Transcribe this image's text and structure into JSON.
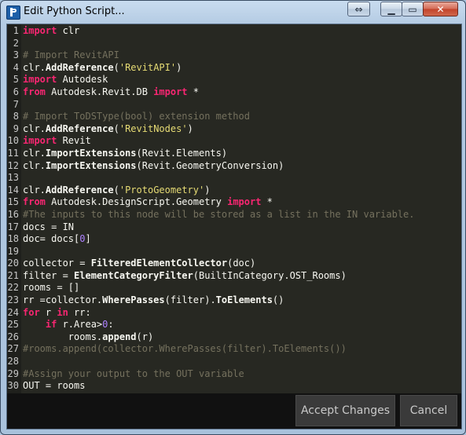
{
  "window": {
    "title": "Edit Python Script...",
    "controls": {
      "restore_icon": "⇔",
      "minimize_icon": "▁",
      "maximize_icon": "▭",
      "close_icon": "✕"
    }
  },
  "editor": {
    "lines": [
      [
        {
          "t": "import",
          "c": "kw"
        },
        {
          "t": " clr",
          "c": ""
        }
      ],
      [],
      [
        {
          "t": "# Import RevitAPI",
          "c": "cm"
        }
      ],
      [
        {
          "t": "clr.",
          "c": ""
        },
        {
          "t": "AddReference",
          "c": "fn"
        },
        {
          "t": "(",
          "c": ""
        },
        {
          "t": "'RevitAPI'",
          "c": "str"
        },
        {
          "t": ")",
          "c": ""
        }
      ],
      [
        {
          "t": "import",
          "c": "kw"
        },
        {
          "t": " Autodesk",
          "c": ""
        }
      ],
      [
        {
          "t": "from",
          "c": "kw"
        },
        {
          "t": " Autodesk.Revit.DB ",
          "c": ""
        },
        {
          "t": "import",
          "c": "kw"
        },
        {
          "t": " *",
          "c": ""
        }
      ],
      [],
      [
        {
          "t": "# Import ToDSType(bool) extension method",
          "c": "cm"
        }
      ],
      [
        {
          "t": "clr.",
          "c": ""
        },
        {
          "t": "AddReference",
          "c": "fn"
        },
        {
          "t": "(",
          "c": ""
        },
        {
          "t": "'RevitNodes'",
          "c": "str"
        },
        {
          "t": ")",
          "c": ""
        }
      ],
      [
        {
          "t": "import",
          "c": "kw"
        },
        {
          "t": " Revit",
          "c": ""
        }
      ],
      [
        {
          "t": "clr.",
          "c": ""
        },
        {
          "t": "ImportExtensions",
          "c": "fn"
        },
        {
          "t": "(Revit.Elements)",
          "c": ""
        }
      ],
      [
        {
          "t": "clr.",
          "c": ""
        },
        {
          "t": "ImportExtensions",
          "c": "fn"
        },
        {
          "t": "(Revit.GeometryConversion)",
          "c": ""
        }
      ],
      [],
      [
        {
          "t": "clr.",
          "c": ""
        },
        {
          "t": "AddReference",
          "c": "fn"
        },
        {
          "t": "(",
          "c": ""
        },
        {
          "t": "'ProtoGeometry'",
          "c": "str"
        },
        {
          "t": ")",
          "c": ""
        }
      ],
      [
        {
          "t": "from",
          "c": "kw"
        },
        {
          "t": " Autodesk.DesignScript.Geometry ",
          "c": ""
        },
        {
          "t": "import",
          "c": "kw"
        },
        {
          "t": " *",
          "c": ""
        }
      ],
      [
        {
          "t": "#The inputs to this node will be stored as a list in the IN variable.",
          "c": "cm"
        }
      ],
      [
        {
          "t": "docs = IN",
          "c": ""
        }
      ],
      [
        {
          "t": "doc= docs[",
          "c": ""
        },
        {
          "t": "0",
          "c": "num"
        },
        {
          "t": "]",
          "c": ""
        }
      ],
      [],
      [
        {
          "t": "collector = ",
          "c": ""
        },
        {
          "t": "FilteredElementCollector",
          "c": "fn"
        },
        {
          "t": "(doc)",
          "c": ""
        }
      ],
      [
        {
          "t": "filter = ",
          "c": ""
        },
        {
          "t": "ElementCategoryFilter",
          "c": "fn"
        },
        {
          "t": "(BuiltInCategory.OST_Rooms)",
          "c": ""
        }
      ],
      [
        {
          "t": "rooms = []",
          "c": ""
        }
      ],
      [
        {
          "t": "rr =collector.",
          "c": ""
        },
        {
          "t": "WherePasses",
          "c": "fn"
        },
        {
          "t": "(filter).",
          "c": ""
        },
        {
          "t": "ToElements",
          "c": "fn"
        },
        {
          "t": "()",
          "c": ""
        }
      ],
      [
        {
          "t": "for",
          "c": "kw"
        },
        {
          "t": " r ",
          "c": ""
        },
        {
          "t": "in",
          "c": "kw"
        },
        {
          "t": " rr:",
          "c": ""
        }
      ],
      [
        {
          "t": "    ",
          "c": ""
        },
        {
          "t": "if",
          "c": "kw"
        },
        {
          "t": " r.Area>",
          "c": ""
        },
        {
          "t": "0",
          "c": "num"
        },
        {
          "t": ":",
          "c": ""
        }
      ],
      [
        {
          "t": "        rooms.",
          "c": ""
        },
        {
          "t": "append",
          "c": "fn"
        },
        {
          "t": "(r)",
          "c": ""
        }
      ],
      [
        {
          "t": "#rooms.append(collector.WherePasses(filter).ToElements())",
          "c": "cm"
        }
      ],
      [],
      [
        {
          "t": "#Assign your output to the OUT variable",
          "c": "cm"
        }
      ],
      [
        {
          "t": "OUT = rooms",
          "c": ""
        }
      ]
    ]
  },
  "buttons": {
    "accept_label": "Accept Changes",
    "cancel_label": "Cancel"
  }
}
